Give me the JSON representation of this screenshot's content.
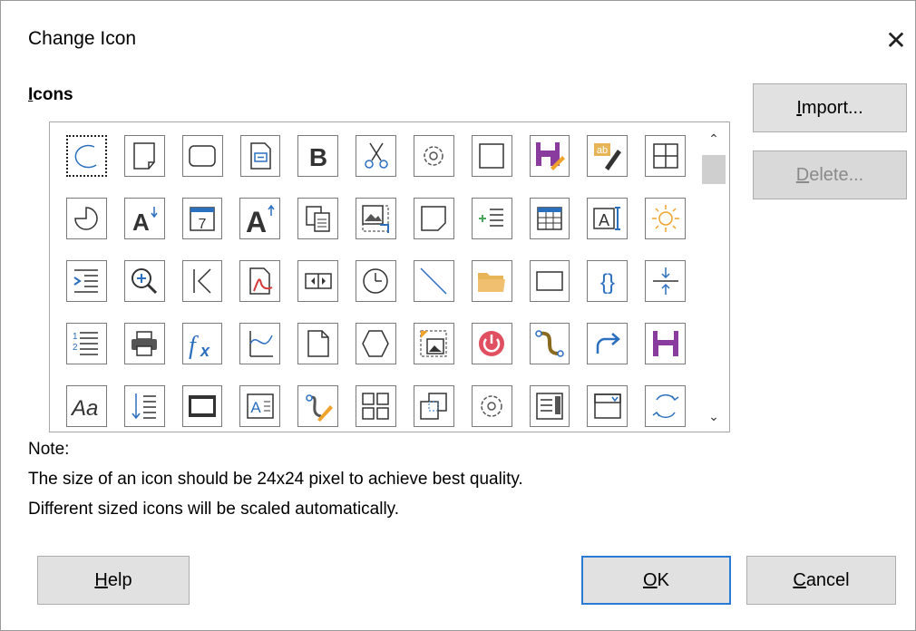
{
  "window": {
    "title": "Change Icon",
    "close_glyph": "✕"
  },
  "icons_section": {
    "label_mnemonic": "I",
    "label_rest": "cons"
  },
  "buttons": {
    "import": {
      "mn": "I",
      "rest": "mport..."
    },
    "delete": {
      "mn": "D",
      "rest": "elete..."
    },
    "help": {
      "mn": "H",
      "rest": "elp"
    },
    "ok": {
      "mn": "O",
      "rest": "K"
    },
    "cancel": {
      "mn": "C",
      "rest": "ancel"
    }
  },
  "scroll": {
    "up": "⌃",
    "down": "⌄"
  },
  "note": {
    "heading": "Note:",
    "line1": "The size of an icon should be 24x24 pixel to achieve best quality.",
    "line2": "Different sized icons will be scaled automatically."
  },
  "icon_grid": [
    [
      "arc-icon",
      "page-icon",
      "rounded-rect-icon",
      "field-icon",
      "bold-icon",
      "cut-icon",
      "gear-icon",
      "square-icon",
      "save-edit-icon",
      "text-edit-icon",
      "table-border-icon"
    ],
    [
      "pie-icon",
      "font-shrink-icon",
      "calendar-icon",
      "font-grow-icon",
      "paste-icon",
      "image-crop-icon",
      "note-icon",
      "insert-list-icon",
      "table-icon",
      "text-field-icon",
      "sun-icon"
    ],
    [
      "indent-icon",
      "zoom-in-icon",
      "first-page-icon",
      "pdf-icon",
      "columns-icon",
      "clock-icon",
      "line-icon",
      "folder-icon",
      "rectangle-icon",
      "braces-icon",
      "compress-icon"
    ],
    [
      "numbered-list-icon",
      "print-icon",
      "formula-icon",
      "edit-points-icon",
      "blank-page-icon",
      "hexagon-icon",
      "insert-image-icon",
      "power-icon",
      "bezier-icon",
      "redo-icon",
      "save-icon"
    ],
    [
      "font-style-icon",
      "sort-icon",
      "film-frame-icon",
      "text-box-icon",
      "edit-curve-icon",
      "layout-icon",
      "duplicate-icon",
      "settings-icon",
      "form-icon",
      "combobox-icon",
      "rotate-icon"
    ]
  ],
  "colors": {
    "accent": "#2a7bd6",
    "purple": "#8a3b9e",
    "orange": "#f0a32a",
    "gold": "#e7b557",
    "red": "#e05060",
    "green": "#4aa65a",
    "blue": "#2b6fbf"
  }
}
